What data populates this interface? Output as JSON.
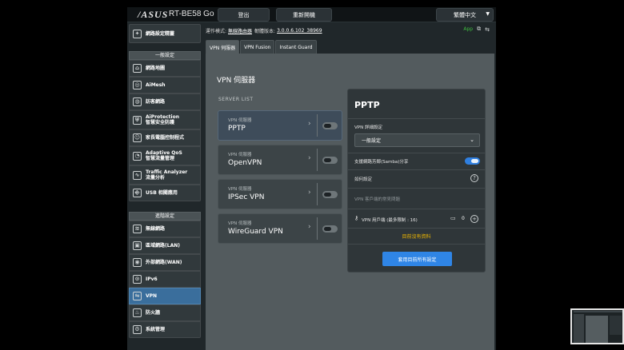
{
  "header": {
    "brand": "/ASUS",
    "model": "RT-BE58 Go",
    "logout": "登出",
    "reboot": "重新開機",
    "language": "繁體中文"
  },
  "infobar": {
    "mode_label": "運作模式:",
    "mode_value": "無線路由器",
    "firmware_label": "韌體版本:",
    "firmware_value": "3.0.0.6.102_38969",
    "app_label": "App"
  },
  "sidebar": {
    "wizard": "網路設定精靈",
    "general_header": "一般設定",
    "general": [
      {
        "label": "網路地圖",
        "icon": "map-icon"
      },
      {
        "label": "AiMesh",
        "icon": "mesh-icon"
      },
      {
        "label": "訪客網路",
        "icon": "globe-icon"
      },
      {
        "label": "AiProtection\n智慧安全防護",
        "icon": "shield-icon"
      },
      {
        "label": "家長電腦控制程式",
        "icon": "family-icon"
      },
      {
        "label": "Adaptive QoS\n智慧流量管理",
        "icon": "gauge-icon"
      },
      {
        "label": "Traffic Analyzer\n流量分析",
        "icon": "chart-icon"
      },
      {
        "label": "USB 相關應用",
        "icon": "usb-icon"
      }
    ],
    "advanced_header": "進階設定",
    "advanced": [
      {
        "label": "無線網路",
        "icon": "wifi-icon"
      },
      {
        "label": "區域網路(LAN)",
        "icon": "lan-icon"
      },
      {
        "label": "外部網路(WAN)",
        "icon": "wan-icon"
      },
      {
        "label": "IPv6",
        "icon": "ipv6-icon"
      },
      {
        "label": "VPN",
        "icon": "vpn-icon"
      },
      {
        "label": "防火牆",
        "icon": "firewall-icon"
      },
      {
        "label": "系統管理",
        "icon": "admin-icon"
      }
    ]
  },
  "tabs": [
    "VPN 伺服器",
    "VPN Fusion",
    "Instant Guard"
  ],
  "page": {
    "title": "VPN 伺服器",
    "server_list_label": "SERVER LIST"
  },
  "servers": [
    {
      "caption": "VPN 伺服器",
      "name": "PPTP"
    },
    {
      "caption": "VPN 伺服器",
      "name": "OpenVPN"
    },
    {
      "caption": "VPN 伺服器",
      "name": "IPSec VPN"
    },
    {
      "caption": "VPN 伺服器",
      "name": "WireGuard VPN"
    }
  ],
  "panel": {
    "title": "PPTP",
    "detail_label": "VPN 詳細設定",
    "detail_value": "一般設定",
    "samba_label": "支援網路芳鄰(Samba)分享",
    "howto_label": "如何設定",
    "client_faq": "VPN 客戶端的常見問題",
    "users_label": "VPN 用戶端 (最多限制 : 16)",
    "users_count": "0",
    "no_data": "目前沒有資料",
    "apply": "套用目前所有設定"
  },
  "colors": {
    "accent": "#2f85e6",
    "no_data": "#f0b800",
    "app": "#3fbf3f"
  }
}
